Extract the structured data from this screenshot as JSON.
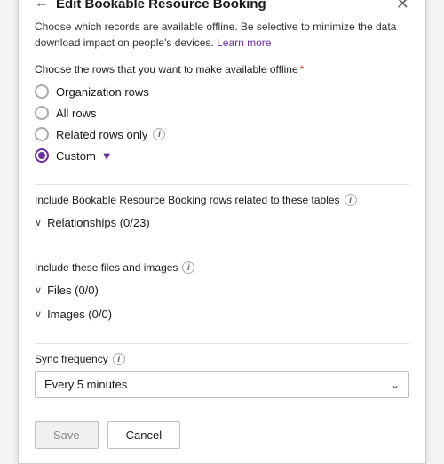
{
  "dialog": {
    "title": "Edit Bookable Resource Booking",
    "description": "Choose which records are available offline. Be selective to minimize the data download impact on people's devices.",
    "learn_more_label": "Learn more",
    "section_rows_label": "Choose the rows that you want to make available offline",
    "radio_options": [
      {
        "id": "org",
        "label": "Organization rows",
        "selected": false
      },
      {
        "id": "all",
        "label": "All rows",
        "selected": false
      },
      {
        "id": "related",
        "label": "Related rows only",
        "has_info": true,
        "selected": false
      },
      {
        "id": "custom",
        "label": "Custom",
        "has_filter": true,
        "selected": true
      }
    ],
    "include_section_label": "Include Bookable Resource Booking rows related to these tables",
    "relationships_label": "Relationships (0/23)",
    "files_section_label": "Include these files and images",
    "files_label": "Files (0/0)",
    "images_label": "Images (0/0)",
    "sync_label": "Sync frequency",
    "sync_value": "Every 5 minutes",
    "save_label": "Save",
    "cancel_label": "Cancel"
  },
  "icons": {
    "back": "←",
    "close": "✕",
    "info": "i",
    "filter": "▼",
    "chevron_down": "∨",
    "select_chevron": "⌄"
  },
  "colors": {
    "accent": "#6b2fa0",
    "border": "#c0c0c0",
    "text_primary": "#1a1a1a",
    "text_muted": "#666"
  }
}
